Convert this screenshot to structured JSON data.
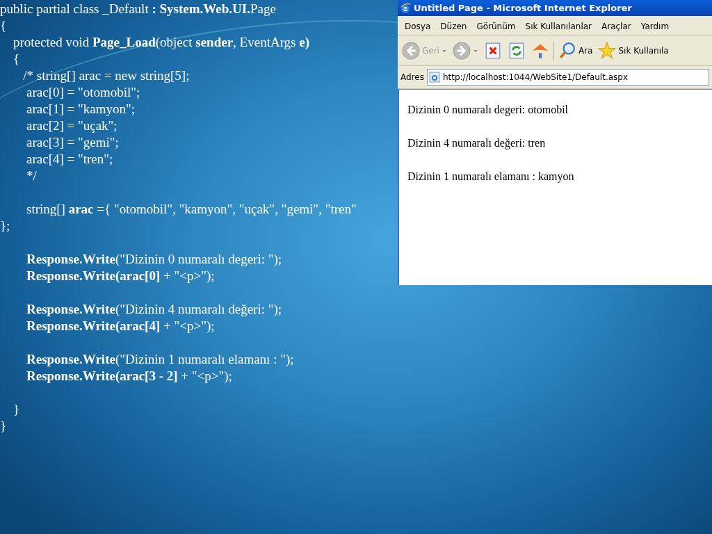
{
  "slide": {
    "code_blocks": [
      [
        "public partial class _Default **: System.Web.UI.**Page",
        "{",
        "    protected void **Page_Load**(object **sender**, EventArgs **e)**",
        "    {",
        "       /* string[] arac = new string[5];",
        "        arac[0] = \"otomobil\";",
        "        arac[1] = \"kamyon\";",
        "        arac[2] = \"uçak\";",
        "        arac[3] = \"gemi\";",
        "        arac[4] = \"tren\";",
        "        */"
      ],
      [
        "        string[] **arac** ={ \"otomobil\", \"kamyon\", \"uçak\", \"gemi\", \"tren\"",
        "};"
      ],
      [
        "        **Response.Write**(\"Dizinin 0 numaralı degeri: \");",
        "        **Response.Write(arac[0]** + \"<p>\");"
      ],
      [
        "        **Response.Write**(\"Dizinin 4 numaralı değeri: \");",
        "        **Response.Write(arac[4]** + \"<p>\");"
      ],
      [
        "        **Response.Write**(\"Dizinin 1 numaralı elamanı : \");",
        "        **Response.Write(arac[3 - 2]** + \"<p>\");"
      ],
      [
        "    }",
        "}"
      ]
    ]
  },
  "browser": {
    "title": "Untitled Page - Microsoft Internet Explorer",
    "menu": [
      "Dosya",
      "Düzen",
      "Görünüm",
      "Sık Kullanılanlar",
      "Araçlar",
      "Yardım"
    ],
    "toolbar": [
      {
        "kind": "back",
        "label": "Geri"
      },
      {
        "kind": "forward"
      },
      {
        "kind": "stop"
      },
      {
        "kind": "refresh"
      },
      {
        "kind": "home"
      },
      {
        "kind": "search",
        "label": "Ara"
      },
      {
        "kind": "favorites",
        "label": "Sık Kullanıla"
      }
    ],
    "address": {
      "label": "Adres",
      "value": "http://localhost:1044/WebSite1/Default.aspx"
    },
    "content": [
      "Dizinin 0 numaralı degeri: otomobil",
      "Dizinin 4 numaralı değeri: tren",
      "Dizinin 1 numaralı elamanı : kamyon"
    ]
  }
}
